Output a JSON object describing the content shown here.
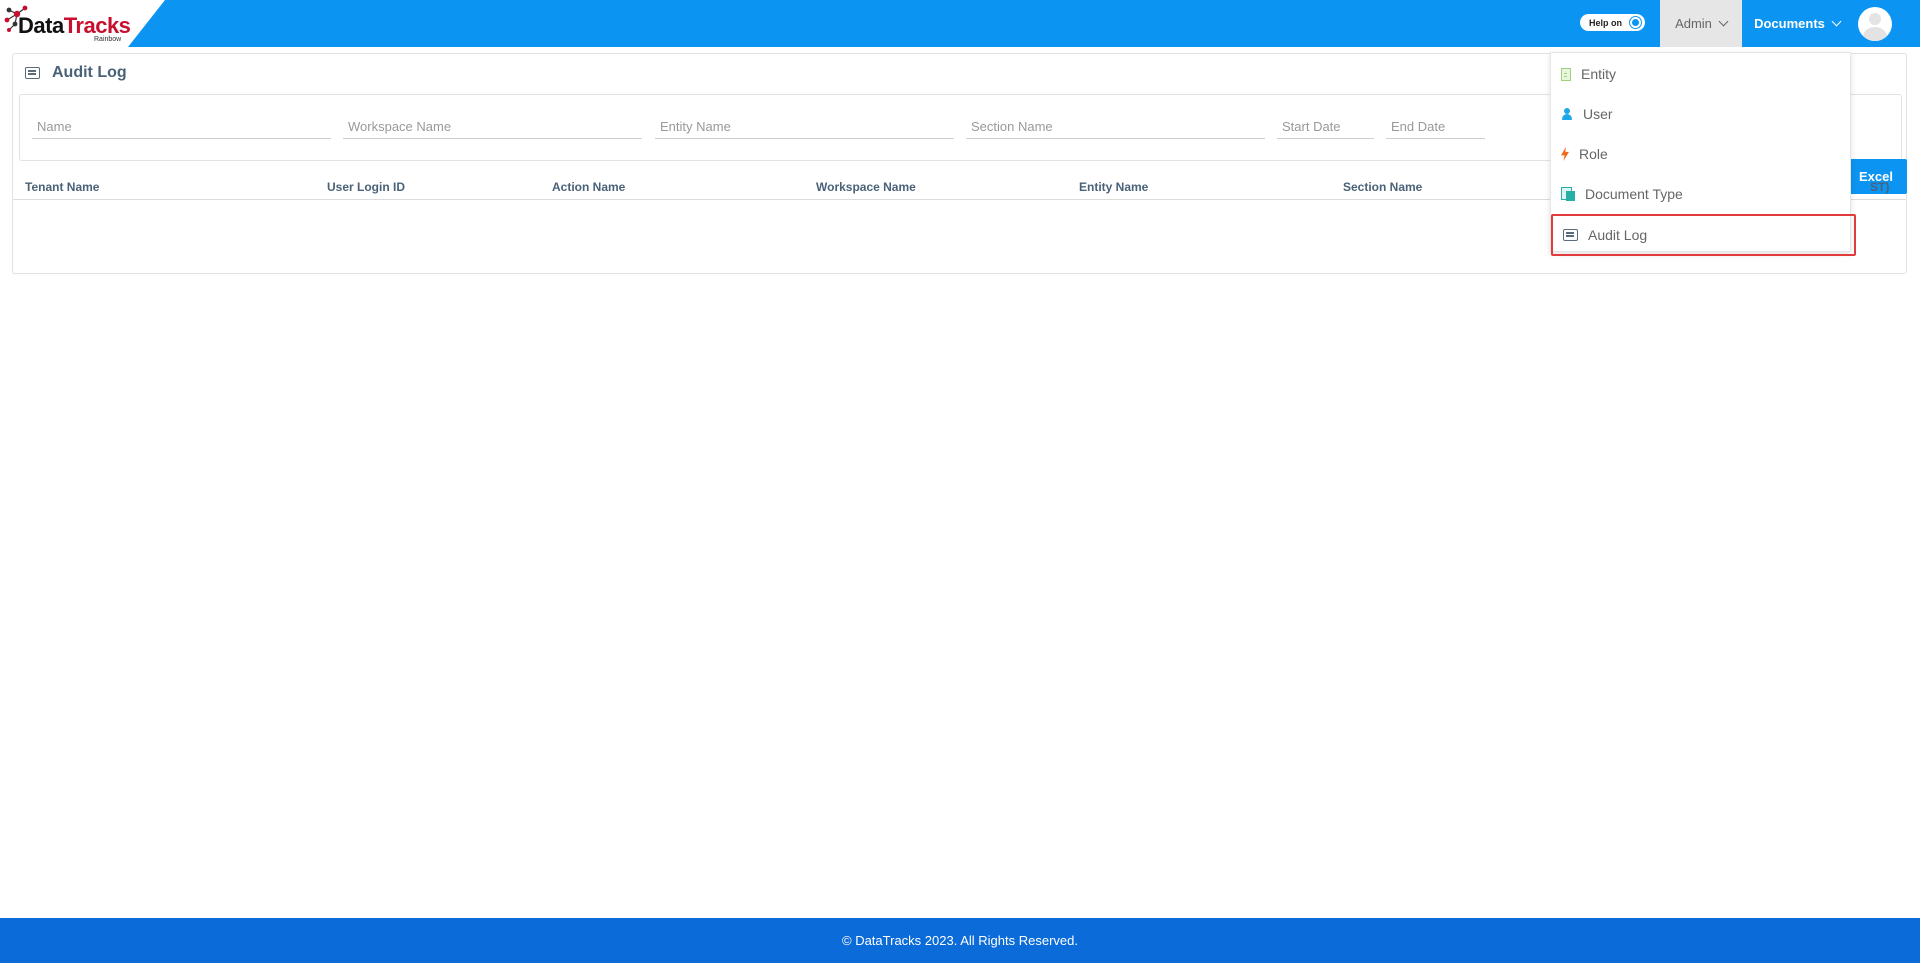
{
  "header": {
    "logo_text_1": "Data",
    "logo_text_2": "Tracks",
    "logo_sub": "Rainbow",
    "help_toggle_label": "Help on",
    "admin_label": "Admin",
    "documents_label": "Documents"
  },
  "page": {
    "title": "Audit Log",
    "excel_label": "Excel"
  },
  "filters": {
    "name_placeholder": "Name",
    "workspace_placeholder": "Workspace Name",
    "entity_placeholder": "Entity Name",
    "section_placeholder": "Section Name",
    "start_date_placeholder": "Start Date",
    "end_date_placeholder": "End Date"
  },
  "table": {
    "columns": [
      "Tenant Name",
      "User Login ID",
      "Action Name",
      "Workspace Name",
      "Entity Name",
      "Section Name",
      "ST)"
    ]
  },
  "admin_dropdown": {
    "items": [
      "Entity",
      "User",
      "Role",
      "Document Type",
      "Audit Log"
    ],
    "selected": "Audit Log"
  },
  "footer": {
    "text": "© DataTracks 2023. All Rights Reserved."
  },
  "colors": {
    "brand_blue": "#0c94f2",
    "footer_blue": "#0b6bd8",
    "highlight_red": "#e23b3b"
  }
}
